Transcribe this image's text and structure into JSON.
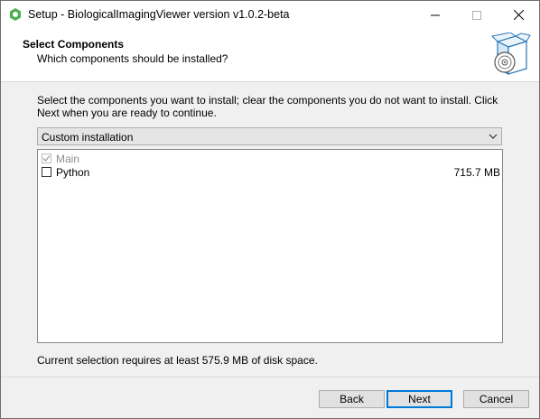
{
  "window": {
    "title": "Setup - BiologicalImagingViewer version v1.0.2-beta"
  },
  "header": {
    "title": "Select Components",
    "subtitle": "Which components should be installed?"
  },
  "body": {
    "description": "Select the components you want to install; clear the components you do not want to install. Click Next when you are ready to continue.",
    "install_type": "Custom installation",
    "components": [
      {
        "label": "Main",
        "size": "",
        "checked": true,
        "disabled": true
      },
      {
        "label": "Python",
        "size": "715.7 MB",
        "checked": false,
        "disabled": false
      }
    ],
    "requirement": "Current selection requires at least 575.9 MB of disk space."
  },
  "footer": {
    "back_label": "Back",
    "next_label": "Next",
    "cancel_label": "Cancel"
  },
  "colors": {
    "accent": "#0078d7",
    "brand_green": "#4caf50"
  }
}
